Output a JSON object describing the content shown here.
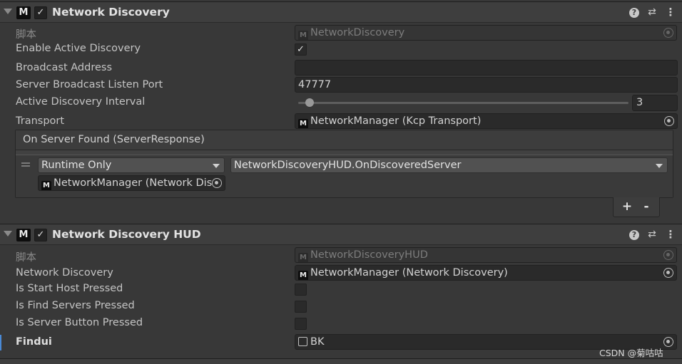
{
  "components": [
    {
      "title": "Network Discovery",
      "enabled": "✓",
      "script_label": "脚本",
      "script_value": "NetworkDiscovery",
      "enable_active_discovery": {
        "label": "Enable Active Discovery",
        "checked": "✓"
      },
      "broadcast_address": {
        "label": "Broadcast Address",
        "value": ""
      },
      "server_broadcast_listen_port": {
        "label": "Server Broadcast Listen Port",
        "value": "47777"
      },
      "active_discovery_interval": {
        "label": "Active Discovery Interval",
        "value": "3"
      },
      "transport": {
        "label": "Transport",
        "value": "NetworkManager (Kcp Transport)"
      },
      "event": {
        "header": "On Server Found (ServerResponse)",
        "runtime": "Runtime Only",
        "function": "NetworkDiscoveryHUD.OnDiscoveredServer",
        "target": "NetworkManager (Network Dis",
        "plus": "+",
        "minus": "-"
      }
    },
    {
      "title": "Network Discovery HUD",
      "enabled": "✓",
      "script_label": "脚本",
      "script_value": "NetworkDiscoveryHUD",
      "network_discovery": {
        "label": "Network Discovery",
        "value": "NetworkManager (Network Discovery)"
      },
      "is_start_host_pressed": {
        "label": "Is Start Host Pressed"
      },
      "is_find_servers_pressed": {
        "label": "Is Find Servers Pressed"
      },
      "is_server_button_pressed": {
        "label": "Is Server Button Pressed"
      },
      "findui": {
        "label": "Findui",
        "value": "BK"
      }
    }
  ],
  "watermark": "CSDN @菊咕咕"
}
